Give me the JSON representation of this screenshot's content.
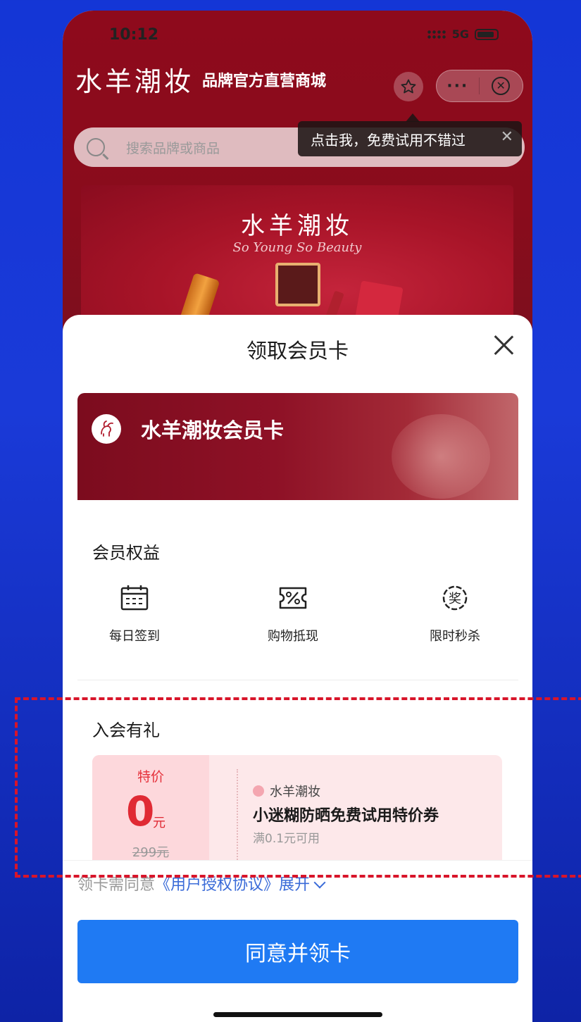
{
  "status_bar": {
    "time": "10:12",
    "network": "5G"
  },
  "header": {
    "brand_logo": "水羊潮妆",
    "brand_subtitle": "品牌官方直营商城",
    "fav_icon": "star-icon",
    "more_icon": "···",
    "close_icon": "⊗"
  },
  "tooltip": {
    "text": "点击我，免费试用不错过",
    "close": "✕"
  },
  "search": {
    "placeholder": "搜索品牌或商品"
  },
  "banner": {
    "title": "水羊潮妆",
    "subtitle": "So Young So Beauty"
  },
  "sheet": {
    "title": "领取会员卡",
    "card_name": "水羊潮妆会员卡",
    "benefits_title": "会员权益",
    "benefits": [
      {
        "label": "每日签到",
        "icon": "calendar-icon"
      },
      {
        "label": "购物抵现",
        "icon": "discount-icon"
      },
      {
        "label": "限时秒杀",
        "icon": "prize-icon"
      }
    ],
    "gift_title": "入会有礼",
    "gift": {
      "tag": "特价",
      "price": "0",
      "unit": "元",
      "original": "299元",
      "brand": "水羊潮妆",
      "title": "小迷糊防晒免费试用特价券",
      "condition": "满0.1元可用"
    },
    "agreement_prefix": "领卡需同意",
    "agreement_link": "《用户授权协议》展开",
    "button": "同意并领卡"
  },
  "colors": {
    "accent": "#1f7af3",
    "brand_red": "#8e0a1c",
    "price_red": "#e02a34",
    "highlight": "#d8152a"
  }
}
